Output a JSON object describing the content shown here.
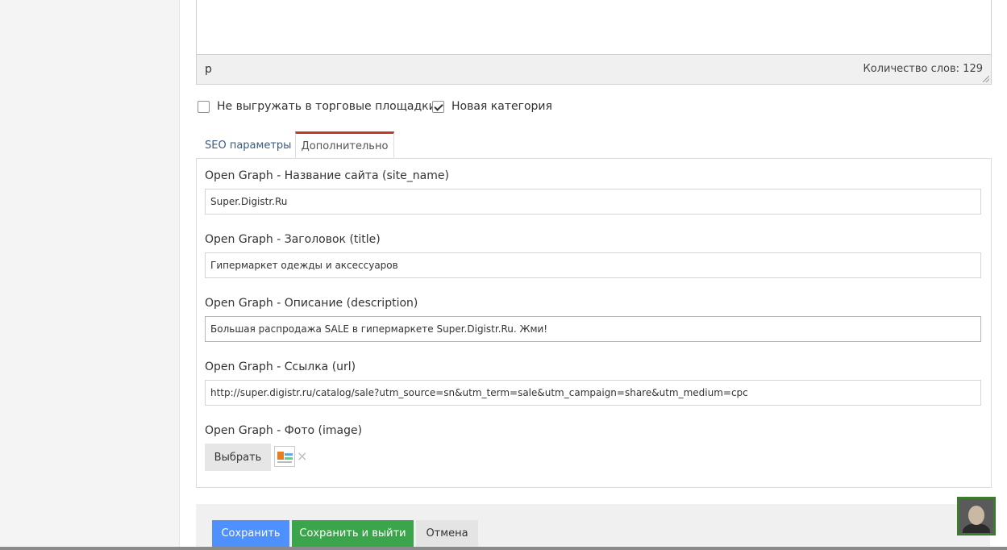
{
  "editor": {
    "path": "p",
    "word_count": "Количество слов: 129"
  },
  "options": {
    "no_export_label": "Не выгружать в торговые площадки",
    "no_export_checked": false,
    "new_category_label": "Новая категория",
    "new_category_checked": true
  },
  "tabs": [
    {
      "label": "SEO параметры",
      "active": false
    },
    {
      "label": "Дополнительно",
      "active": true
    }
  ],
  "fields": {
    "site_name": {
      "label": "Open Graph - Название сайта (site_name)",
      "value": "Super.Digistr.Ru"
    },
    "title": {
      "label": "Open Graph - Заголовок (title)",
      "value": "Гипермаркет одежды и аксессуаров"
    },
    "description": {
      "label": "Open Graph - Описание (description)",
      "value": "Большая распродажа SALE в гипермаркете Super.Digistr.Ru. Жми!"
    },
    "url": {
      "label": "Open Graph - Ссылка (url)",
      "value": "http://super.digistr.ru/catalog/sale?utm_source=sn&utm_term=sale&utm_campaign=share&utm_medium=cpc"
    },
    "image": {
      "label": "Open Graph - Фото (image)",
      "choose_label": "Выбрать",
      "remove_glyph": "×"
    }
  },
  "actions": {
    "save": "Сохранить",
    "save_exit": "Сохранить и выйти",
    "cancel": "Отмена"
  },
  "colors": {
    "active_tab_accent": "#c0392b",
    "save": "#4d90fe",
    "save_exit": "#3aa54a",
    "avatar_border": "#3d7a2f"
  }
}
